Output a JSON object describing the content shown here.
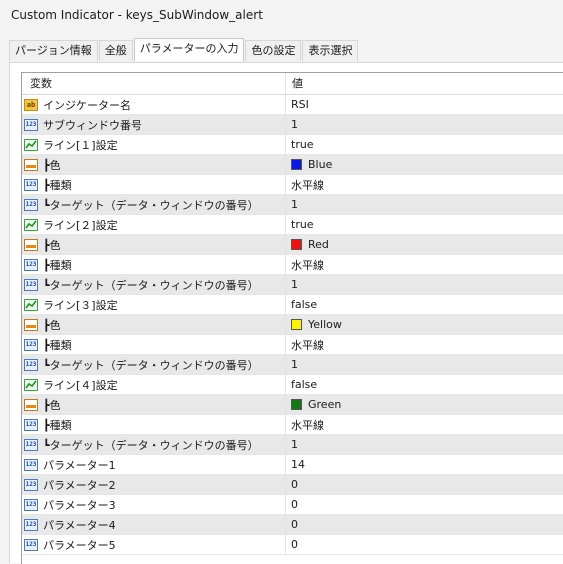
{
  "window": {
    "title": "Custom Indicator - keys_SubWindow_alert"
  },
  "tabs": [
    {
      "label": "パージョン情報"
    },
    {
      "label": "全般"
    },
    {
      "label": "パラメーターの入力"
    },
    {
      "label": "色の設定"
    },
    {
      "label": "表示選択"
    }
  ],
  "grid": {
    "headers": {
      "variable": "変数",
      "value": "値"
    },
    "rows": [
      {
        "icon": "ab-icon",
        "label": "インジケーター名",
        "value": "RSI"
      },
      {
        "icon": "number-icon",
        "label": "サブウィンドウ番号",
        "value": "1"
      },
      {
        "icon": "line-icon",
        "label": "ライン[１]設定",
        "value": "true"
      },
      {
        "icon": "color-icon",
        "label": "┣色",
        "value": "Blue",
        "swatch": "#0b17e6"
      },
      {
        "icon": "number-icon",
        "label": "┣種類",
        "value": "水平線"
      },
      {
        "icon": "number-icon",
        "label": "┗ターゲット（データ・ウィンドウの番号）",
        "value": "1"
      },
      {
        "icon": "line-icon",
        "label": "ライン[２]設定",
        "value": "true"
      },
      {
        "icon": "color-icon",
        "label": "┣色",
        "value": "Red",
        "swatch": "#f21111"
      },
      {
        "icon": "number-icon",
        "label": "┣種類",
        "value": "水平線"
      },
      {
        "icon": "number-icon",
        "label": "┗ターゲット（データ・ウィンドウの番号）",
        "value": "1"
      },
      {
        "icon": "line-icon",
        "label": "ライン[３]設定",
        "value": "false"
      },
      {
        "icon": "color-icon",
        "label": "┣色",
        "value": "Yellow",
        "swatch": "#fff200"
      },
      {
        "icon": "number-icon",
        "label": "┣種類",
        "value": "水平線"
      },
      {
        "icon": "number-icon",
        "label": "┗ターゲット（データ・ウィンドウの番号）",
        "value": "1"
      },
      {
        "icon": "line-icon",
        "label": "ライン[４]設定",
        "value": "false"
      },
      {
        "icon": "color-icon",
        "label": "┣色",
        "value": "Green",
        "swatch": "#127a12"
      },
      {
        "icon": "number-icon",
        "label": "┣種類",
        "value": "水平線"
      },
      {
        "icon": "number-icon",
        "label": "┗ターゲット（データ・ウィンドウの番号）",
        "value": "1"
      },
      {
        "icon": "number-icon",
        "label": "パラメーター1",
        "value": "14"
      },
      {
        "icon": "number-icon",
        "label": "パラメーター2",
        "value": "0"
      },
      {
        "icon": "number-icon",
        "label": "パラメーター3",
        "value": "0"
      },
      {
        "icon": "number-icon",
        "label": "パラメーター4",
        "value": "0"
      },
      {
        "icon": "number-icon",
        "label": "パラメーター5",
        "value": "0"
      }
    ]
  }
}
